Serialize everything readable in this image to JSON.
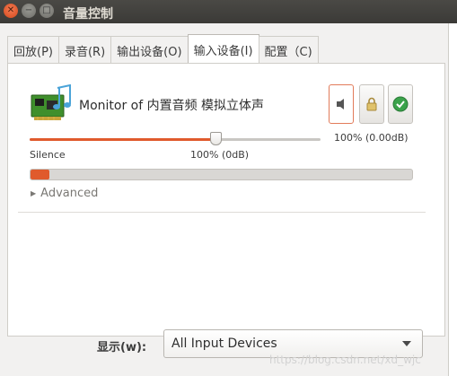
{
  "window": {
    "title": "音量控制"
  },
  "tabs": [
    {
      "label": "回放(P)",
      "active": false
    },
    {
      "label": "录音(R)",
      "active": false
    },
    {
      "label": "输出设备(O)",
      "active": false
    },
    {
      "label": "输入设备(I)",
      "active": true
    },
    {
      "label": "配置（C)",
      "active": false
    }
  ],
  "device": {
    "name": "Monitor of 内置音频 模拟立体声",
    "icon": "audio-card-icon",
    "volume_text": "100% (0.00dB)",
    "volume_fraction": 0.64,
    "silence_label": "Silence",
    "hundred_label": "100% (0dB)",
    "level_fraction": 0.05,
    "mute_icon": "speaker-muted-icon",
    "lock_icon": "lock-icon",
    "fallback_icon": "check-circle-icon"
  },
  "advanced": {
    "label": "Advanced"
  },
  "footer": {
    "show_label": "显示(w):",
    "show_value": "All Input Devices"
  },
  "watermark": "https://blog.csdn.net/xd_wjc",
  "colors": {
    "accent": "#e05a2c",
    "titlebar": "#3b3a37"
  }
}
